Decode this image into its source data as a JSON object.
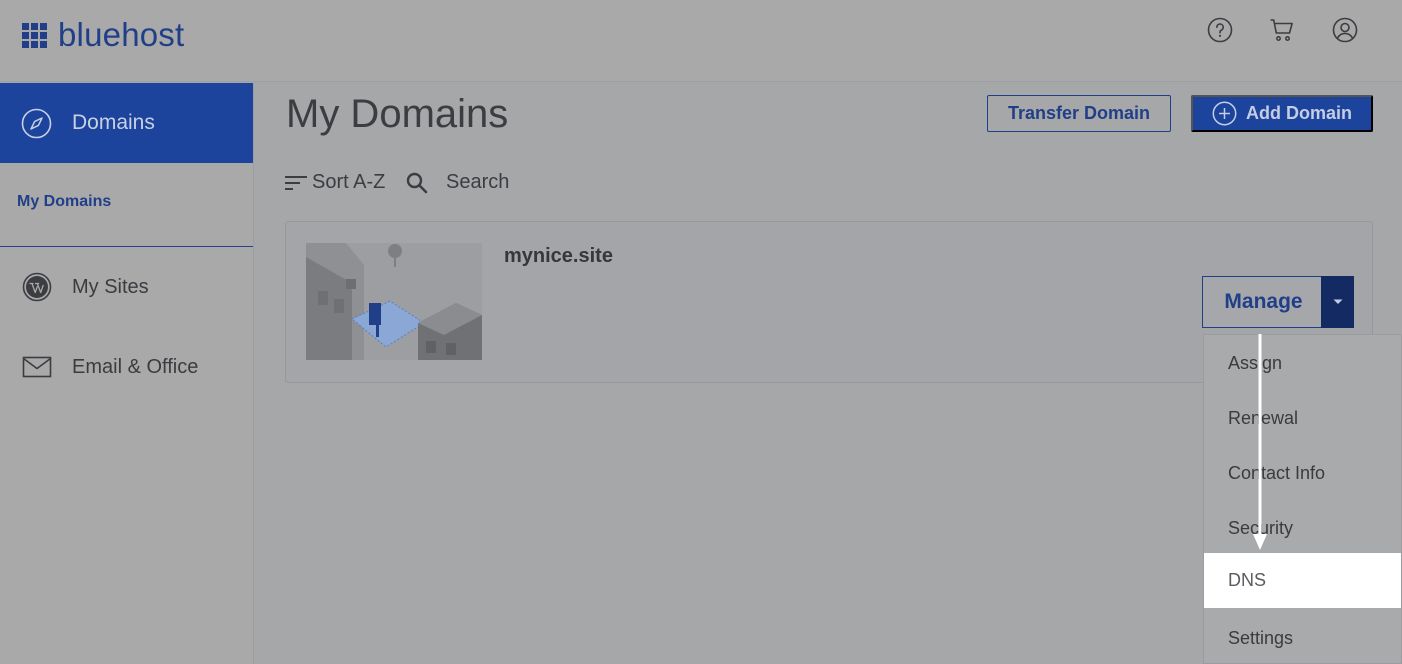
{
  "header": {
    "brand": "bluehost",
    "icons": [
      "help-icon",
      "cart-icon",
      "account-icon"
    ]
  },
  "sidebar": {
    "active_item": {
      "label": "Domains",
      "icon": "compass-icon"
    },
    "sub_item": {
      "label": "My Domains"
    },
    "items": [
      {
        "label": "My Sites",
        "icon": "wordpress-icon"
      },
      {
        "label": "Email & Office",
        "icon": "mail-icon"
      }
    ]
  },
  "main": {
    "title": "My Domains",
    "transfer_label": "Transfer Domain",
    "add_label": "Add Domain",
    "sort_label": "Sort A-Z",
    "search_label": "Search"
  },
  "domain_card": {
    "name": "mynice.site",
    "manage_label": "Manage"
  },
  "dropdown": {
    "items": [
      "Assign",
      "Renewal",
      "Contact Info",
      "Security",
      "DNS",
      "Settings"
    ],
    "highlighted": "DNS"
  },
  "colors": {
    "brand_blue": "#1c449c",
    "dark_navy": "#132a63",
    "overlay_gray": "#a5a7a9",
    "highlight": "#ffffff"
  }
}
